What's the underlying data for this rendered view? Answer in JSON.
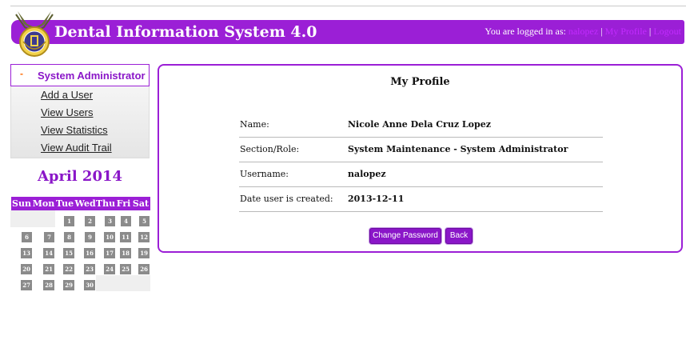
{
  "header": {
    "app_title": "Dental Information System 4.0",
    "logged_in_prefix": "You are logged in as:",
    "username_link": "nalopez",
    "my_profile_link": "My Profile",
    "logout_link": "Logout",
    "separator": "|"
  },
  "sidebar": {
    "group_marker": "-",
    "group_label": "System Administrator",
    "items": [
      {
        "label": "Add a User"
      },
      {
        "label": "View Users"
      },
      {
        "label": "View Statistics"
      },
      {
        "label": "View Audit Trail"
      }
    ]
  },
  "calendar": {
    "title": "April 2014",
    "weekdays": [
      "Sun",
      "Mon",
      "Tue",
      "Wed",
      "Thu",
      "Fri",
      "Sat"
    ],
    "weeks": [
      [
        "",
        "",
        "1",
        "2",
        "3",
        "4",
        "5"
      ],
      [
        "6",
        "7",
        "8",
        "9",
        "10",
        "11",
        "12"
      ],
      [
        "13",
        "14",
        "15",
        "16",
        "17",
        "18",
        "19"
      ],
      [
        "20",
        "21",
        "22",
        "23",
        "24",
        "25",
        "26"
      ],
      [
        "27",
        "28",
        "29",
        "30",
        "",
        "",
        ""
      ]
    ]
  },
  "profile": {
    "title": "My Profile",
    "fields": [
      {
        "label": "Name:",
        "value": "Nicole Anne Dela Cruz Lopez"
      },
      {
        "label": "Section/Role:",
        "value": "System Maintenance - System Administrator"
      },
      {
        "label": "Username:",
        "value": "nalopez"
      },
      {
        "label": "Date user is created:",
        "value": "2013-12-11"
      }
    ],
    "change_password_button": "Change Password",
    "back_button": "Back"
  },
  "colors": {
    "brand_purple": "#9b1fd6",
    "accent_orange": "#ff6a00"
  }
}
